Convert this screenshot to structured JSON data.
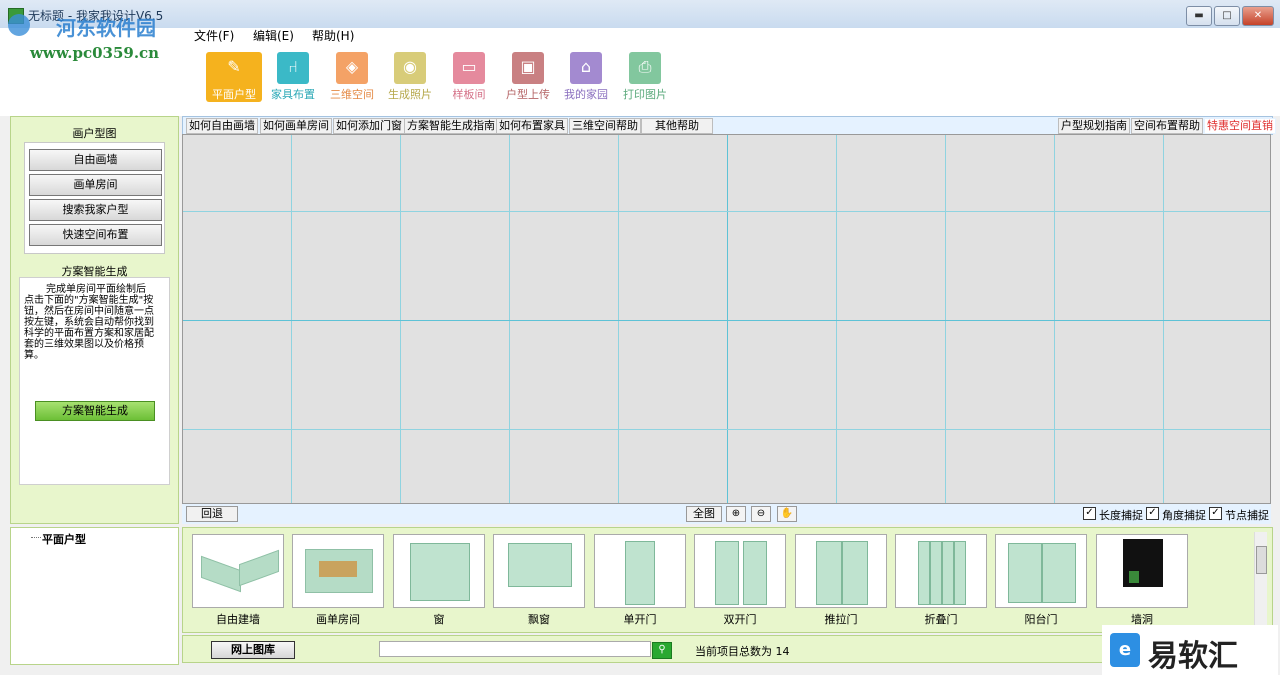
{
  "window": {
    "title": "无标题 - 我家我设计V6.5",
    "min_label": "▬",
    "max_label": "□",
    "close_label": "✕"
  },
  "watermark": {
    "line1": "河东软件园",
    "line2": "www.pc0359.cn"
  },
  "menu": {
    "items": [
      "文件(F)",
      "编辑(E)",
      "帮助(H)"
    ]
  },
  "toolbar": {
    "buttons": [
      {
        "label": "平面户型",
        "icon": "pencil-icon",
        "color": "#f5b21e"
      },
      {
        "label": "家具布置",
        "icon": "chair-icon",
        "color": "#3bb9c7"
      },
      {
        "label": "三维空间",
        "icon": "cube-icon",
        "color": "#f4a266"
      },
      {
        "label": "生成照片",
        "icon": "camera-icon",
        "color": "#d8cc79"
      },
      {
        "label": "样板间",
        "icon": "sofa-icon",
        "color": "#e58a9d"
      },
      {
        "label": "户型上传",
        "icon": "disk-icon",
        "color": "#c98082"
      },
      {
        "label": "我的家园",
        "icon": "house-icon",
        "color": "#a38ad0"
      },
      {
        "label": "打印图片",
        "icon": "printer-icon",
        "color": "#82c79e"
      }
    ]
  },
  "left_panel": {
    "title": "画户型图",
    "buttons": [
      "自由画墙",
      "画单房间",
      "搜索我家户型",
      "快速空间布置"
    ],
    "smart_title": "方案智能生成",
    "smart_desc": "完成单房间平面绘制后点击下面的\"方案智能生成\"按钮，然后在房间中间随意一点按左键，系统会自动帮你找到科学的平面布置方案和家居配套的三维效果图以及价格预算。",
    "smart_button": "方案智能生成"
  },
  "help_bar": {
    "left": [
      "如何自由画墙",
      "如何画单房间",
      "如何添加门窗",
      "方案智能生成指南",
      "如何布置家具",
      "三维空间帮助",
      "其他帮助"
    ],
    "right": [
      "户型规划指南",
      "空间布置帮助"
    ],
    "special": "特惠空间直销",
    "special_color": "#e03030"
  },
  "canvas_bar": {
    "back": "回退",
    "fit": "全图",
    "zoom_in": "⊕",
    "zoom_out": "⊖",
    "pan": "✋",
    "checks": [
      {
        "label": "长度捕捉",
        "checked": true
      },
      {
        "label": "角度捕捉",
        "checked": true
      },
      {
        "label": "节点捕捉",
        "checked": true
      }
    ],
    "check_mark": "✓"
  },
  "tree": {
    "item": "平面户型"
  },
  "gallery": {
    "items": [
      "自由建墙",
      "画单房间",
      "窗",
      "飘窗",
      "单开门",
      "双开门",
      "推拉门",
      "折叠门",
      "阳台门",
      "墙洞"
    ]
  },
  "footer": {
    "online_button": "网上图库",
    "search_value": "",
    "count_text": "当前项目总数为 14"
  },
  "brand": {
    "text": "易软汇"
  }
}
